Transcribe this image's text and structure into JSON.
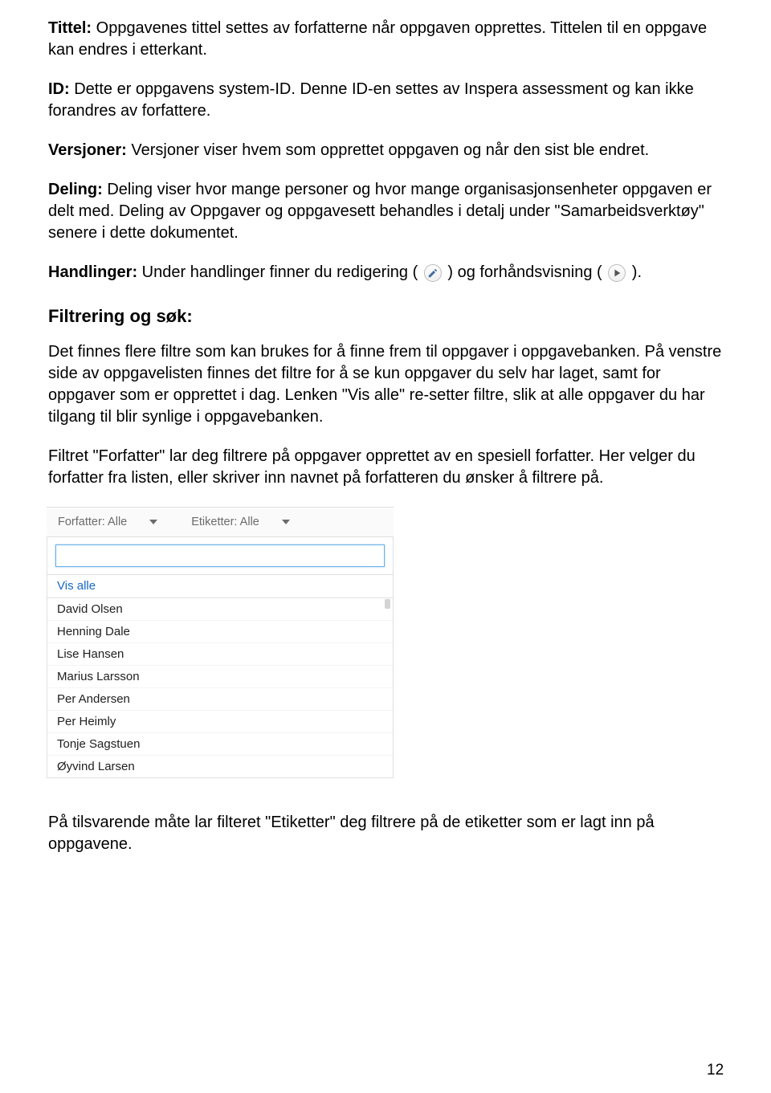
{
  "paras": {
    "tittel_label": "Tittel:",
    "tittel_text": " Oppgavenes tittel settes av forfatterne når oppgaven opprettes. Tittelen til en oppgave kan endres i etterkant.",
    "id_label": "ID:",
    "id_text": " Dette er oppgavens system-ID. Denne ID-en settes av Inspera assessment og kan ikke forandres av forfattere.",
    "versjoner_label": "Versjoner:",
    "versjoner_text": " Versjoner viser hvem som opprettet oppgaven og når den sist ble endret.",
    "deling_label": "Deling:",
    "deling_text": " Deling viser hvor mange personer og hvor mange organisasjonsenheter oppgaven er delt med. Deling av Oppgaver og oppgavesett behandles i detalj under \"Samarbeidsverktøy\" senere i dette dokumentet.",
    "handlinger_label": "Handlinger:",
    "handlinger_before": " Under handlinger finner du redigering ( ",
    "handlinger_mid": " ) og forhåndsvisning ( ",
    "handlinger_after": " )."
  },
  "filtrering_heading": "Filtrering og søk:",
  "filtrering_p1": "Det finnes flere filtre som kan brukes for å finne frem til oppgaver i oppgavebanken. På venstre side av oppgavelisten finnes det filtre for å se kun oppgaver du selv har laget, samt for oppgaver som er opprettet i dag. Lenken \"Vis alle\" re-setter filtre, slik at alle oppgaver du har tilgang til blir synlige i oppgavebanken.",
  "filtrering_p2": "Filtret \"Forfatter\" lar deg filtrere på oppgaver opprettet av en spesiell forfatter. Her velger du forfatter fra listen, eller skriver inn navnet på forfatteren du ønsker å filtrere på.",
  "filtrering_p3": "På tilsvarende måte lar filteret \"Etiketter\" deg filtrere på de etiketter som er lagt inn på oppgavene.",
  "filter": {
    "forfatter_label": "Forfatter: Alle",
    "etiketter_label": "Etiketter: Alle",
    "search_value": "",
    "vis_alle": "Vis alle",
    "authors": [
      "David Olsen",
      "Henning Dale",
      "Lise Hansen",
      "Marius Larsson",
      "Per Andersen",
      "Per Heimly",
      "Tonje Sagstuen",
      "Øyvind Larsen"
    ]
  },
  "page_number": "12",
  "icons": {
    "pencil": "pencil-icon",
    "play": "play-icon"
  }
}
